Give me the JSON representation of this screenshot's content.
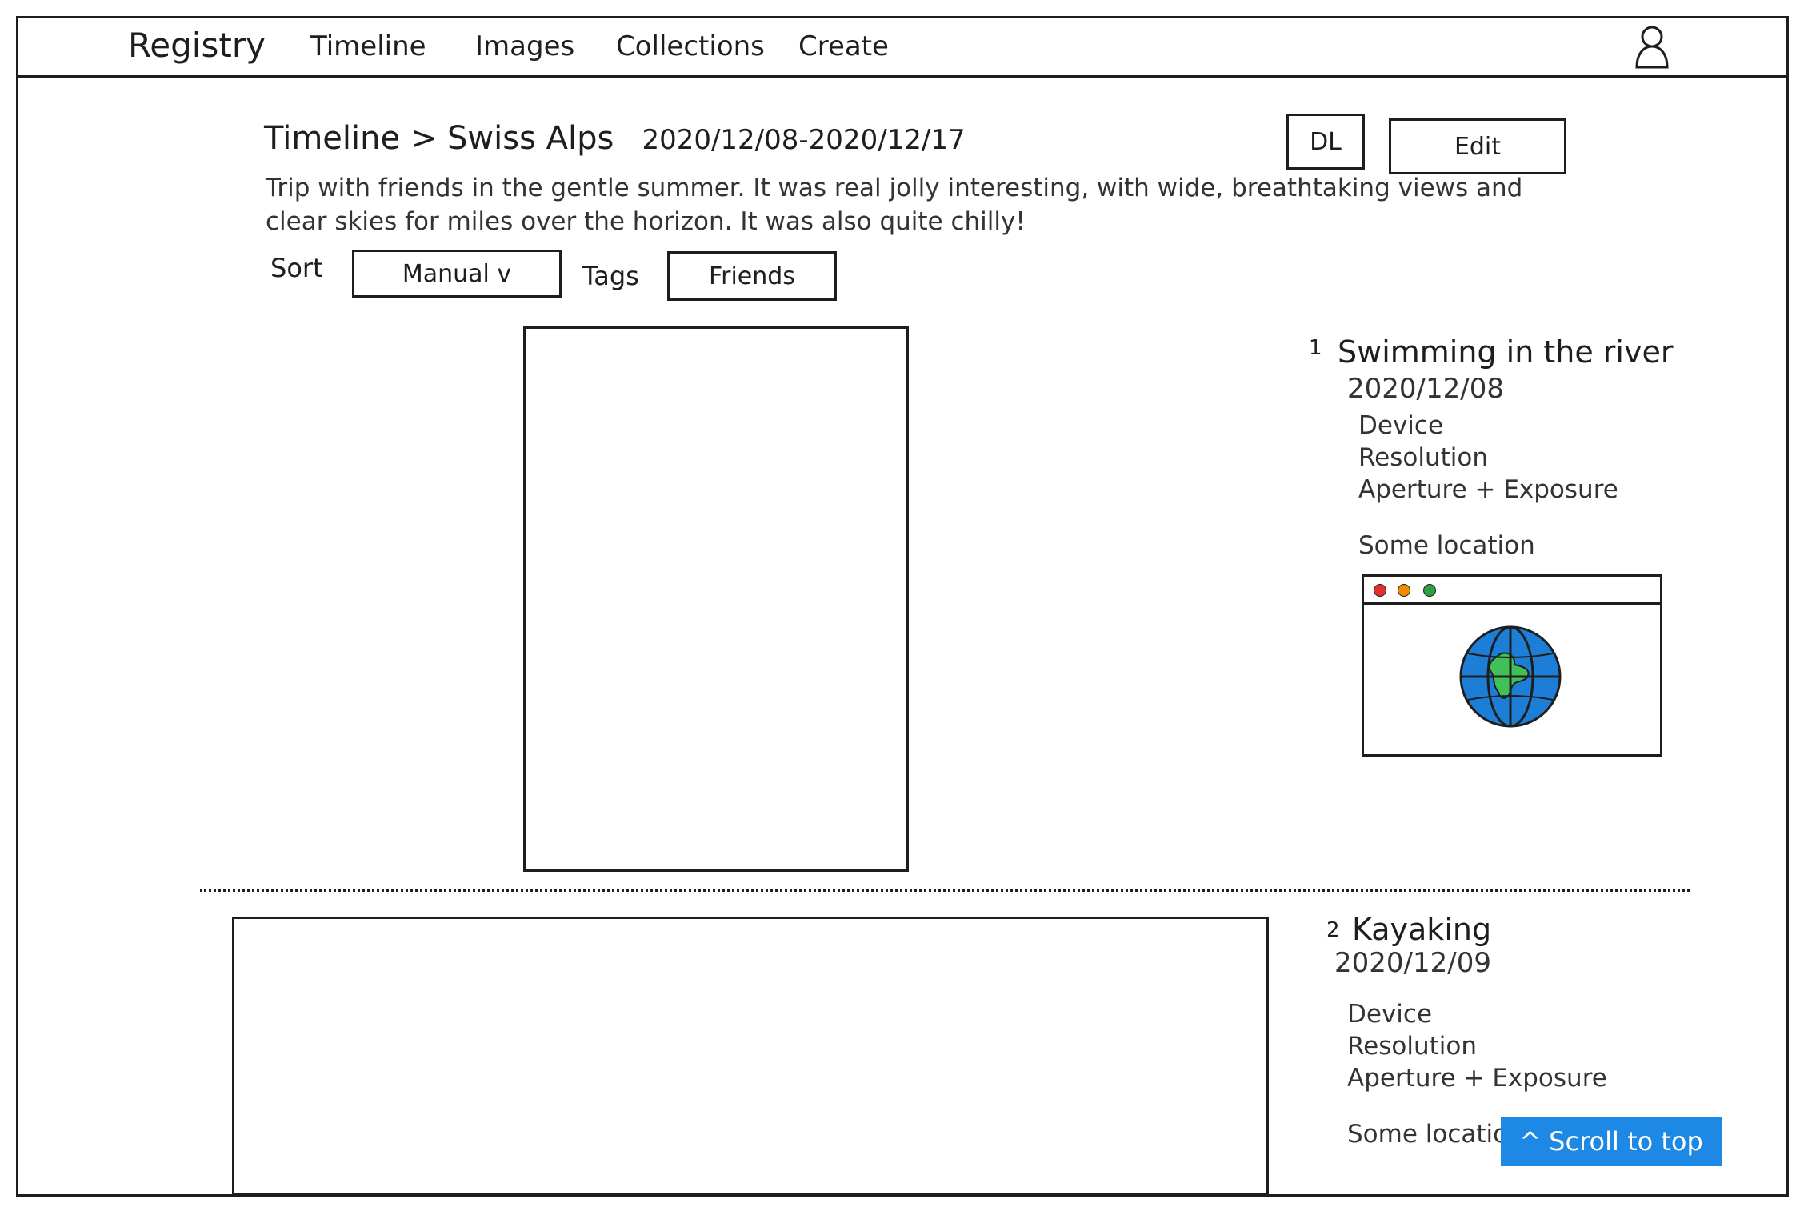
{
  "nav": {
    "brand": "Registry",
    "items": [
      "Timeline",
      "Images",
      "Collections",
      "Create"
    ]
  },
  "header": {
    "breadcrumb": "Timeline > Swiss Alps",
    "date_range": "2020/12/08-2020/12/17",
    "dl_label": "DL",
    "edit_label": "Edit",
    "description": "Trip with friends in the gentle summer. It was real jolly interesting, with wide, breathtaking views and clear skies for miles over the horizon. It was also quite chilly!"
  },
  "filters": {
    "sort_label": "Sort",
    "sort_value": "Manual v",
    "tags_label": "Tags",
    "tags_value": "Friends"
  },
  "entries": [
    {
      "number": "1",
      "title": "Swimming in the river",
      "date": "2020/12/08",
      "device": "Device",
      "resolution": "Resolution",
      "aperture": "Aperture + Exposure",
      "location": "Some location"
    },
    {
      "number": "2",
      "title": "Kayaking",
      "date": "2020/12/09",
      "device": "Device",
      "resolution": "Resolution",
      "aperture": "Aperture + Exposure",
      "location": "Some location"
    }
  ],
  "scroll_top_label": "^ Scroll to top",
  "colors": {
    "accent": "#1e88e5",
    "stroke": "#1e1e1e",
    "dot_red": "#e03131",
    "dot_yellow": "#f08c00",
    "dot_green": "#2f9e44",
    "globe_water": "#1c7ed6",
    "globe_land": "#40c057"
  }
}
